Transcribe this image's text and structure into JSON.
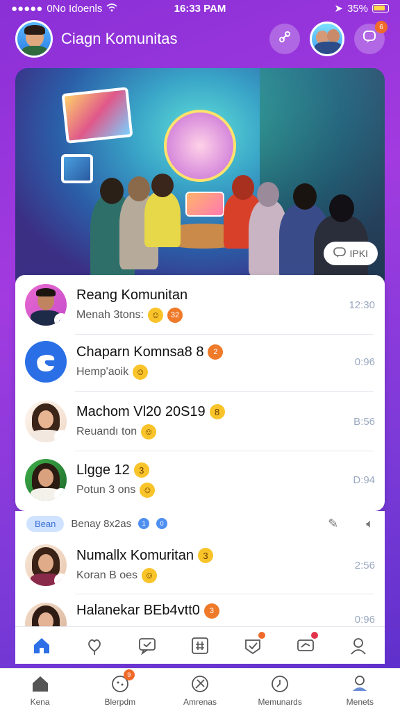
{
  "status_bar": {
    "carrier": "0No Idoenls",
    "time": "16:33 PAM",
    "battery": "35%"
  },
  "header": {
    "title": "Ciagn Komunitas",
    "notification_count": "6"
  },
  "hero": {
    "banner_text": "",
    "pill_label": "IPKI"
  },
  "list": [
    {
      "title": "Reang Komunitan",
      "subtitle": "Menah 3tons:",
      "time": "12:30",
      "title_badge": "",
      "sub_badge": "32"
    },
    {
      "title": "Chaparn Komnsa8 8",
      "subtitle": "Hemp'aoik",
      "time": "0:96",
      "title_badge": "2",
      "sub_badge": ""
    },
    {
      "title": "Machom Vl20 20S19",
      "subtitle": "Reuandı ton",
      "time": "B:56",
      "title_badge": "8",
      "sub_badge": ""
    },
    {
      "title": "Llgge 12",
      "subtitle": "Potun 3 ons",
      "time": "D:94",
      "title_badge": "3",
      "sub_badge": ""
    }
  ],
  "filter": {
    "chip": "Bean",
    "label": "Benay 8x2as",
    "badge1": "1",
    "badge2": "0"
  },
  "list2": [
    {
      "title": "Numallx Komuritan",
      "subtitle": "Koran B oes",
      "time": "2:56",
      "title_badge": "3"
    },
    {
      "title": "Halanekar BEb4vtt0",
      "subtitle": "",
      "time": "0:96",
      "title_badge": "3"
    }
  ],
  "bottom_nav": [
    {
      "label": "Kena",
      "icon": "home-icon"
    },
    {
      "label": "Blerpdm",
      "icon": "compass-icon",
      "badge": "9"
    },
    {
      "label": "Amrenas",
      "icon": "tools-icon"
    },
    {
      "label": "Memunards",
      "icon": "clock-icon"
    },
    {
      "label": "Menets",
      "icon": "profile-icon"
    }
  ]
}
